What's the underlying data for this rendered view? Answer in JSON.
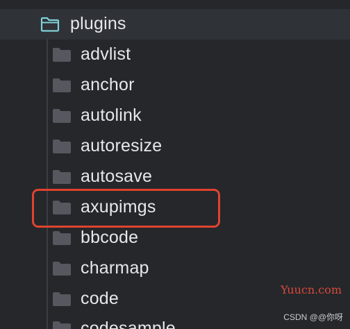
{
  "tree": {
    "parent_folder": {
      "label": "plugins",
      "icon": "folder-open-outline-icon",
      "color": "#7fd3d6"
    },
    "children": [
      {
        "label": "advlist",
        "icon": "folder-icon"
      },
      {
        "label": "anchor",
        "icon": "folder-icon"
      },
      {
        "label": "autolink",
        "icon": "folder-icon"
      },
      {
        "label": "autoresize",
        "icon": "folder-icon"
      },
      {
        "label": "autosave",
        "icon": "folder-icon"
      },
      {
        "label": "axupimgs",
        "icon": "folder-icon",
        "highlighted": true
      },
      {
        "label": "bbcode",
        "icon": "folder-icon"
      },
      {
        "label": "charmap",
        "icon": "folder-icon"
      },
      {
        "label": "code",
        "icon": "folder-icon"
      },
      {
        "label": "codesample",
        "icon": "folder-icon"
      }
    ],
    "folder_color": "#55585e",
    "highlight_color": "#e0432f"
  },
  "overlay": {
    "watermark": "Yuucn.com",
    "credit": "CSDN @@你呀"
  }
}
